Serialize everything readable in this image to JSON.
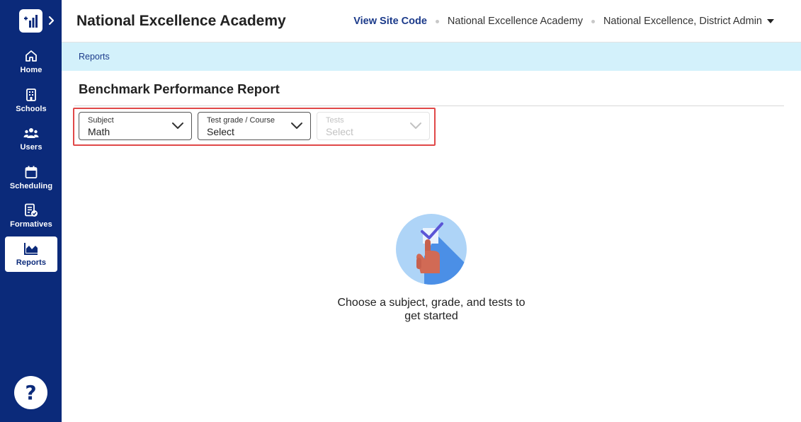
{
  "sidebar": {
    "items": [
      {
        "label": "Home",
        "icon": "home-icon"
      },
      {
        "label": "Schools",
        "icon": "building-icon"
      },
      {
        "label": "Users",
        "icon": "users-icon"
      },
      {
        "label": "Scheduling",
        "icon": "calendar-icon"
      },
      {
        "label": "Formatives",
        "icon": "document-check-icon"
      },
      {
        "label": "Reports",
        "icon": "chart-icon",
        "active": true
      }
    ],
    "help_label": "?"
  },
  "header": {
    "title": "National Excellence Academy",
    "view_site_code": "View Site Code",
    "school_name": "National Excellence Academy",
    "user_role": "National Excellence, District Admin"
  },
  "breadcrumb": {
    "items": [
      "Reports"
    ]
  },
  "page": {
    "title": "Benchmark Performance Report"
  },
  "filters": {
    "subject": {
      "label": "Subject",
      "value": "Math"
    },
    "grade": {
      "label": "Test grade / Course",
      "value": "Select"
    },
    "tests": {
      "label": "Tests",
      "value": "Select",
      "disabled": true
    }
  },
  "empty_state": {
    "message": "Choose a subject, grade, and tests to get started"
  },
  "colors": {
    "sidebar": "#0b2a7a",
    "breadcrumb_bg": "#d3f1fb",
    "highlight_outline": "#e04848",
    "accent": "#1b3a8a"
  }
}
